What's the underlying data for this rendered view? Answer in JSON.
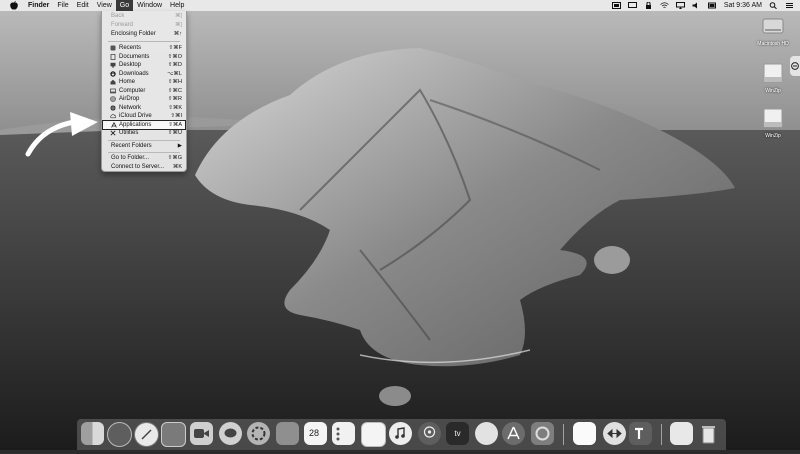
{
  "menubar": {
    "apple_icon": "apple-logo-icon",
    "items": [
      "Finder",
      "File",
      "Edit",
      "View",
      "Go",
      "Window",
      "Help"
    ],
    "active_item": "Go",
    "clock": "Sat 9:36 AM",
    "status_icons": [
      "screen-share-icon",
      "display-icon",
      "lock-icon",
      "wifi-icon",
      "airplay-icon",
      "volume-icon",
      "battery-icon"
    ]
  },
  "go_menu": {
    "items": [
      {
        "label": "Back",
        "shortcut": "⌘[",
        "disabled": true
      },
      {
        "label": "Forward",
        "shortcut": "⌘]",
        "disabled": true
      },
      {
        "label": "Enclosing Folder",
        "shortcut": "⌘↑"
      },
      {
        "label": "Recents",
        "shortcut": "⇧⌘F",
        "icon": "recents-icon"
      },
      {
        "label": "Documents",
        "shortcut": "⇧⌘O",
        "icon": "documents-icon"
      },
      {
        "label": "Desktop",
        "shortcut": "⇧⌘D",
        "icon": "desktop-icon"
      },
      {
        "label": "Downloads",
        "shortcut": "⌥⌘L",
        "icon": "downloads-icon"
      },
      {
        "label": "Home",
        "shortcut": "⇧⌘H",
        "icon": "home-icon"
      },
      {
        "label": "Computer",
        "shortcut": "⇧⌘C",
        "icon": "computer-icon"
      },
      {
        "label": "AirDrop",
        "shortcut": "⇧⌘R",
        "icon": "airdrop-icon"
      },
      {
        "label": "Network",
        "shortcut": "⇧⌘K",
        "icon": "network-icon"
      },
      {
        "label": "iCloud Drive",
        "shortcut": "⇧⌘I",
        "icon": "icloud-icon"
      },
      {
        "label": "Applications",
        "shortcut": "⇧⌘A",
        "icon": "applications-icon",
        "highlighted": true
      },
      {
        "label": "Utilities",
        "shortcut": "⇧⌘U",
        "icon": "utilities-icon"
      },
      {
        "label": "Recent Folders",
        "shortcut": "▶"
      },
      {
        "label": "Go to Folder...",
        "shortcut": "⇧⌘G"
      },
      {
        "label": "Connect to Server...",
        "shortcut": "⌘K"
      }
    ]
  },
  "desktop": {
    "icons": [
      {
        "label": "Macintosh HD",
        "icon": "hard-drive-icon"
      },
      {
        "label": "WinZip",
        "icon": "disk-image-icon"
      },
      {
        "label": "WinZip",
        "icon": "disk-image-icon"
      }
    ],
    "pointer": "white-arrow-pointer-icon"
  },
  "dock": {
    "apps": [
      "finder-icon",
      "launchpad-icon",
      "safari-icon",
      "photo-viewer-icon",
      "facetime-icon",
      "messages-icon",
      "photos-icon",
      "notebook-icon",
      "calendar-icon",
      "reminders-icon",
      "notes-icon",
      "music-icon",
      "podcasts-icon",
      "tv-icon",
      "safari-alt-icon",
      "app-store-icon",
      "system-preferences-icon",
      "window-app-icon",
      "teamviewer-icon",
      "teams-icon",
      "preview-icon",
      "trash-icon"
    ],
    "calendar_day": "28",
    "tv_label": "tv"
  }
}
